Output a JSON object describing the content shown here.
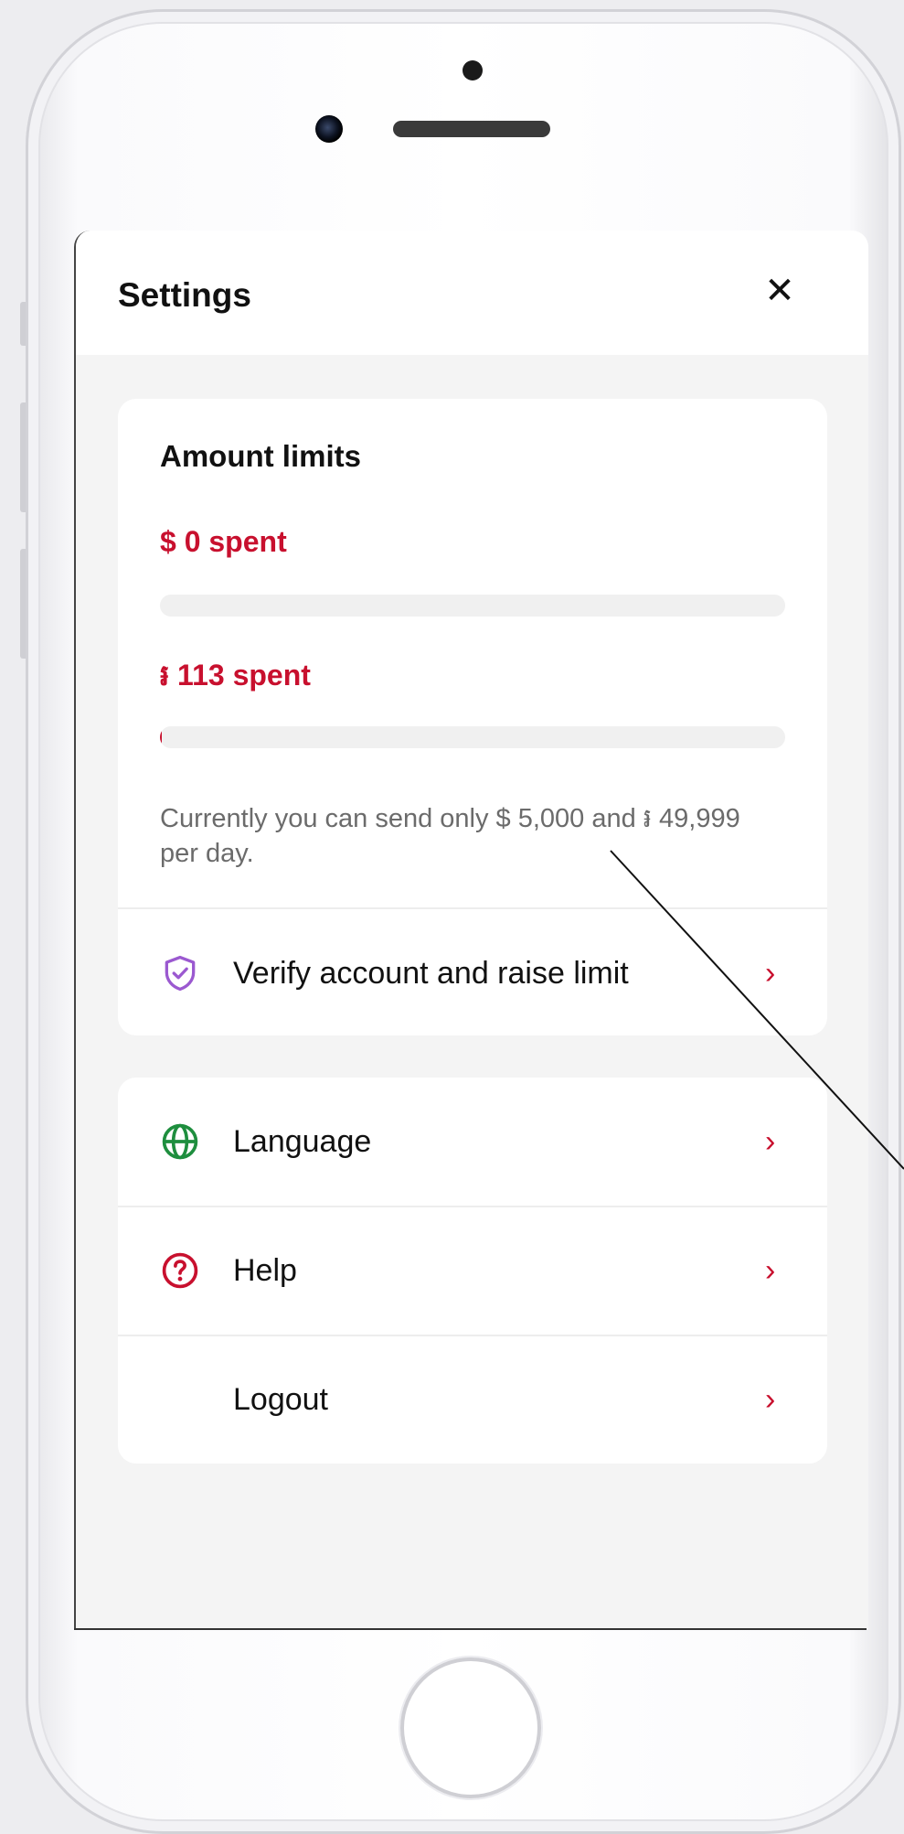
{
  "header": {
    "title": "Settings",
    "close_glyph": "✕"
  },
  "limits": {
    "heading": "Amount limits",
    "usd_spent": "$ 0 spent",
    "usd_progress": 0,
    "khr_spent": "៛ 113 spent",
    "khr_progress": 0.003,
    "note": "Currently you can send only $ 5,000 and ៛ 49,999 per day."
  },
  "menu": {
    "verify": {
      "label": "Verify account and raise limit",
      "icon": "shield-check-icon"
    },
    "language": {
      "label": "Language",
      "icon": "globe-icon"
    },
    "help": {
      "label": "Help",
      "icon": "question-circle-icon"
    },
    "logout": {
      "label": "Logout"
    },
    "chevron": "›"
  },
  "colors": {
    "accent": "#c8102e",
    "shield": "#9b59d0",
    "globe": "#1e8e3e",
    "help": "#c8102e"
  }
}
